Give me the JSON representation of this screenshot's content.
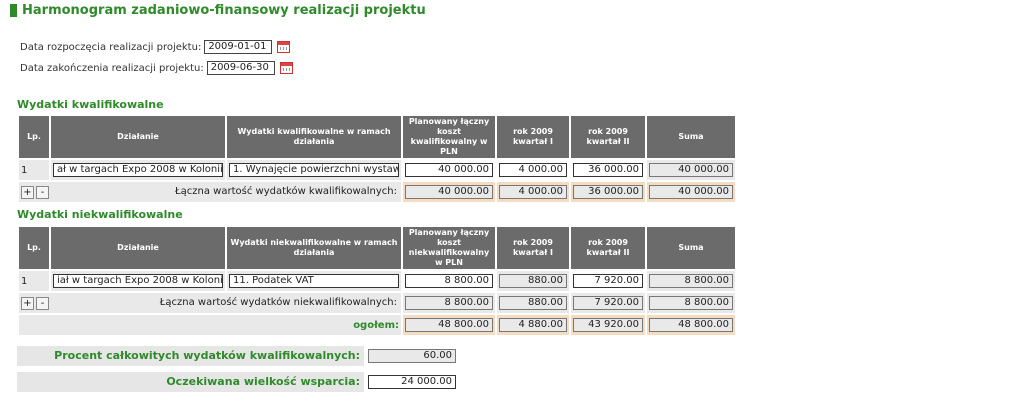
{
  "page": {
    "title": "Harmonogram zadaniowo-finansowy realizacji projektu"
  },
  "dates": {
    "start_label": "Data rozpoczęcia realizacji projektu:",
    "start_value": "2009-01-01",
    "end_label": "Data zakończenia realizacji projektu:",
    "end_value": "2009-06-30"
  },
  "qualified": {
    "section_title": "Wydatki kwalifikowalne",
    "headers": {
      "lp": "Lp.",
      "action": "Działanie",
      "expense": "Wydatki kwalifikowalne w ramach działania",
      "planned": "Planowany łączny koszt kwalifikowalny w PLN",
      "q1": "rok 2009 kwartał I",
      "q2": "rok 2009 kwartał II",
      "sum": "Suma"
    },
    "row": {
      "lp": "1",
      "action": "ał w targach Expo 2008 w Kolonii",
      "expense": "1. Wynajęcie powierzchni wystaw",
      "planned": "40 000.00",
      "q1": "4 000.00",
      "q2": "36 000.00",
      "sum": "40 000.00"
    },
    "total": {
      "label": "Łączna wartość wydatków kwalifikowalnych:",
      "planned": "40 000.00",
      "q1": "4 000.00",
      "q2": "36 000.00",
      "sum": "40 000.00"
    }
  },
  "nonqualified": {
    "section_title": "Wydatki niekwalifikowalne",
    "headers": {
      "lp": "Lp.",
      "action": "Działanie",
      "expense": "Wydatki niekwalifikowalne w ramach działania",
      "planned": "Planowany łączny koszt niekwalifikowalny w PLN",
      "q1": "rok 2009 kwartał I",
      "q2": "rok 2009 kwartał II",
      "sum": "Suma"
    },
    "row": {
      "lp": "1",
      "action": "iał w targach Expo 2008 w Kolonii",
      "expense": "11. Podatek VAT",
      "planned": "8 800.00",
      "q1": "880.00",
      "q2": "7 920.00",
      "sum": "8 800.00"
    },
    "total": {
      "label": "Łączna wartość wydatków niekwalifikowalnych:",
      "planned": "8 800.00",
      "q1": "880.00",
      "q2": "7 920.00",
      "sum": "8 800.00"
    },
    "overall": {
      "label": "ogołem:",
      "planned": "48 800.00",
      "q1": "4 880.00",
      "q2": "43 920.00",
      "sum": "48 800.00"
    }
  },
  "buttons": {
    "add": "+",
    "remove": "-"
  },
  "summary": {
    "percent_label": "Procent całkowitych wydatków kwalifikowalnych:",
    "percent_value": "60.00",
    "support_label": "Oczekiwana wielkość wsparcia:",
    "support_value": "24 000.00"
  },
  "icons": {
    "calendar": "calendar-icon"
  },
  "colors": {
    "accent": "#2f8a2a",
    "header_bg": "#6b6b6b",
    "sum_bg": "#f5dcc0"
  }
}
